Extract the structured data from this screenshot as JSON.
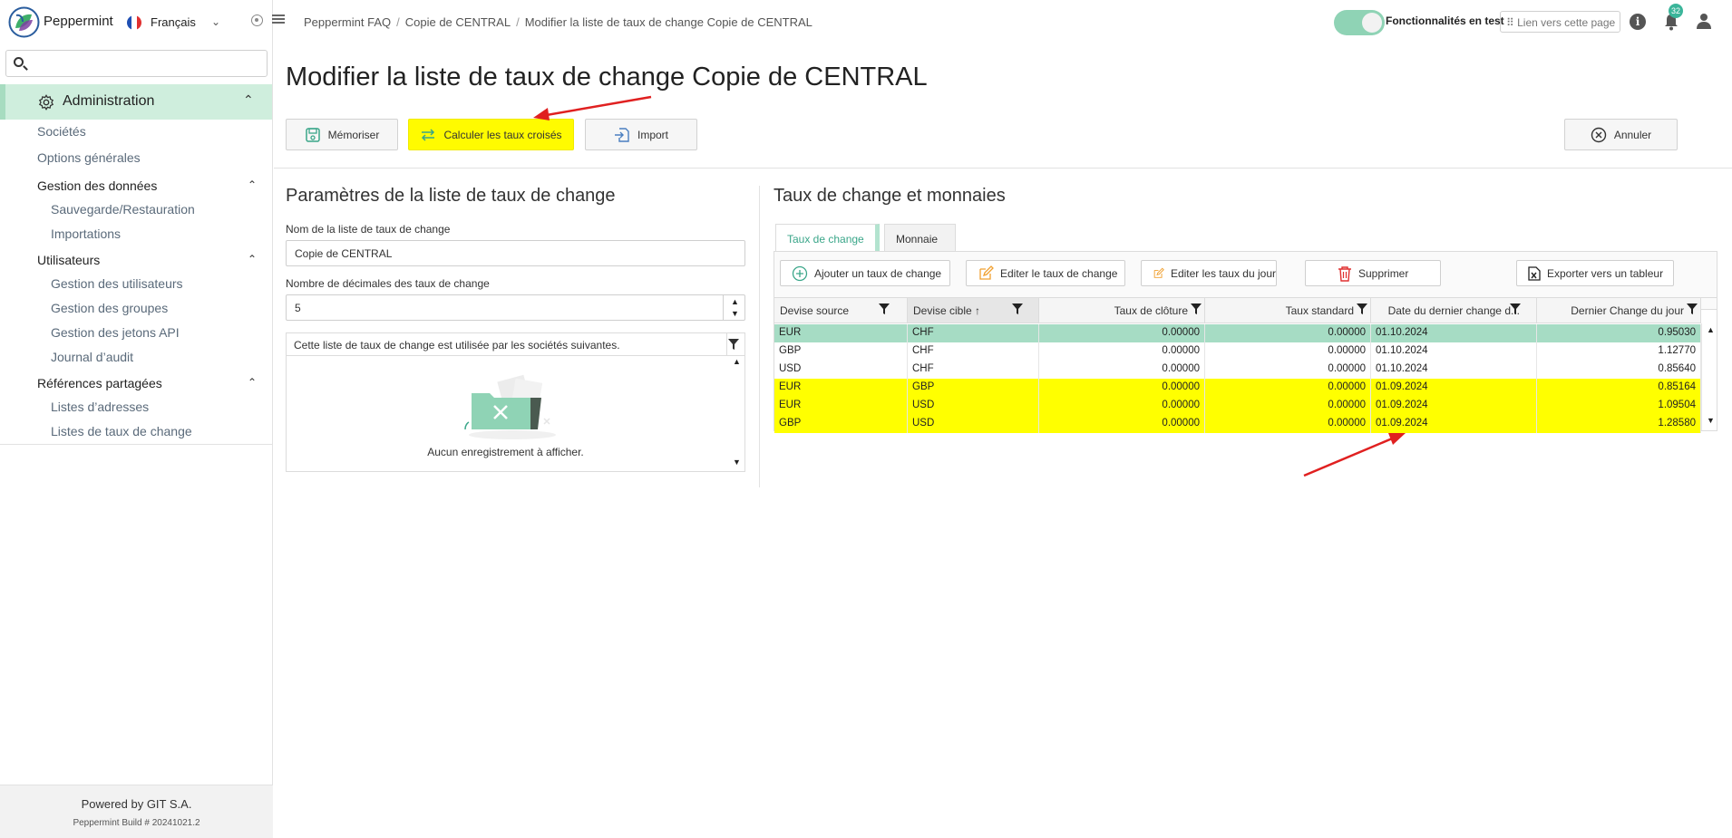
{
  "brand": {
    "name": "Peppermint"
  },
  "language": {
    "selected": "Français"
  },
  "sidebar": {
    "search_placeholder": "",
    "section": "Administration",
    "items": {
      "societes": "Sociétés",
      "options": "Options générales",
      "gestion_donnees": "Gestion des données",
      "sauvegarde": "Sauvegarde/Restauration",
      "importations": "Importations",
      "utilisateurs": "Utilisateurs",
      "gestion_utilisateurs": "Gestion des utilisateurs",
      "gestion_groupes": "Gestion des groupes",
      "gestion_jetons": "Gestion des jetons API",
      "journal": "Journal d’audit",
      "references": "Références partagées",
      "listes_adresses": "Listes d’adresses",
      "listes_taux": "Listes de taux de change"
    },
    "footer": {
      "powered": "Powered by GIT S.A.",
      "build": "Peppermint Build # 20241021.2"
    }
  },
  "header": {
    "breadcrumb": [
      "Peppermint FAQ",
      "Copie de CENTRAL",
      "Modifier la liste de taux de change Copie de CENTRAL"
    ],
    "toggle_label": "Fonctionnalités en test",
    "toggle_on": true,
    "link_btn": "⠿ Lien vers cette page",
    "notifications": "32"
  },
  "page": {
    "title": "Modifier la liste de taux de change Copie de CENTRAL",
    "buttons": {
      "memoriser": "Mémoriser",
      "calculer": "Calculer les taux croisés",
      "import": "Import",
      "annuler": "Annuler"
    }
  },
  "params": {
    "title": "Paramètres de la liste de taux de change",
    "name_label": "Nom de la liste de taux de change",
    "name_value": "Copie de CENTRAL",
    "decimals_label": "Nombre de décimales des taux de change",
    "decimals_value": "5",
    "used_by_header": "Cette liste de taux de change est utilisée par les sociétés suivantes.",
    "empty_text": "Aucun enregistrement à afficher."
  },
  "rates": {
    "title": "Taux de change et monnaies",
    "tabs": [
      "Taux de change",
      "Monnaie"
    ],
    "toolbar": {
      "add": "Ajouter un taux de change",
      "edit": "Editer le taux de change",
      "edit_day": "Editer les taux du jour",
      "delete": "Supprimer",
      "export": "Exporter vers un tableur"
    },
    "columns": [
      "Devise source",
      "Devise cible ↑",
      "Taux de clôture",
      "Taux standard",
      "Date du dernier change d...",
      "Dernier Change du jour"
    ],
    "rows": [
      [
        "EUR",
        "CHF",
        "0.00000",
        "0.00000",
        "01.10.2024",
        "0.95030"
      ],
      [
        "GBP",
        "CHF",
        "0.00000",
        "0.00000",
        "01.10.2024",
        "1.12770"
      ],
      [
        "USD",
        "CHF",
        "0.00000",
        "0.00000",
        "01.10.2024",
        "0.85640"
      ],
      [
        "EUR",
        "GBP",
        "0.00000",
        "0.00000",
        "01.09.2024",
        "0.85164"
      ],
      [
        "EUR",
        "USD",
        "0.00000",
        "0.00000",
        "01.09.2024",
        "1.09504"
      ],
      [
        "GBP",
        "USD",
        "0.00000",
        "0.00000",
        "01.09.2024",
        "1.28580"
      ]
    ],
    "row_states": [
      "selected",
      "normal",
      "normal",
      "highlight",
      "highlight",
      "highlight"
    ]
  },
  "colors": {
    "accent": "#3aa689",
    "selected_row": "#a6dcc4",
    "highlight": "#ffff00",
    "annotation_arrow": "#e02020"
  }
}
